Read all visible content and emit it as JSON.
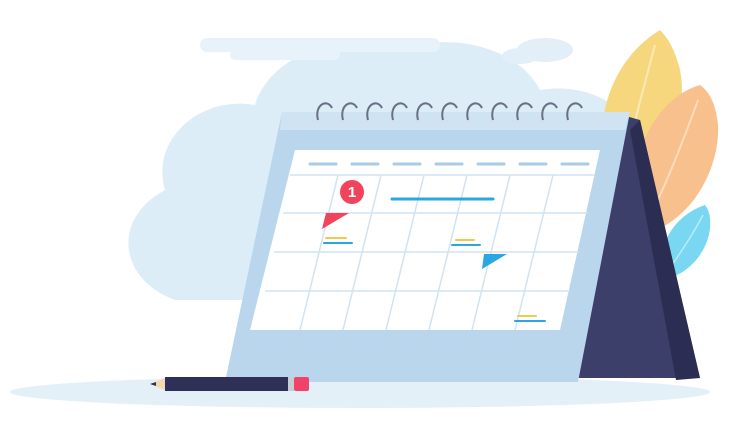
{
  "illustration": {
    "marker_day": "1",
    "colors": {
      "sky_blob": "#dcedf8",
      "cloud": "#e8f2fa",
      "calendar_back": "#3d3f6b",
      "calendar_front": "#cfe3f2",
      "calendar_panel": "#b9d6ec",
      "grid_paper": "#ffffff",
      "grid_line": "#cfe3f2",
      "header_dash": "#a9cbe3",
      "marker_red": "#f0435c",
      "accent_blue": "#2aa7e0",
      "accent_yellow": "#f2c94c",
      "leaf_yellow": "#f6d77e",
      "leaf_orange": "#f7c08d",
      "leaf_blue": "#79d7f1",
      "pencil_body": "#2f3058",
      "pencil_eraser": "#f0436a"
    }
  }
}
